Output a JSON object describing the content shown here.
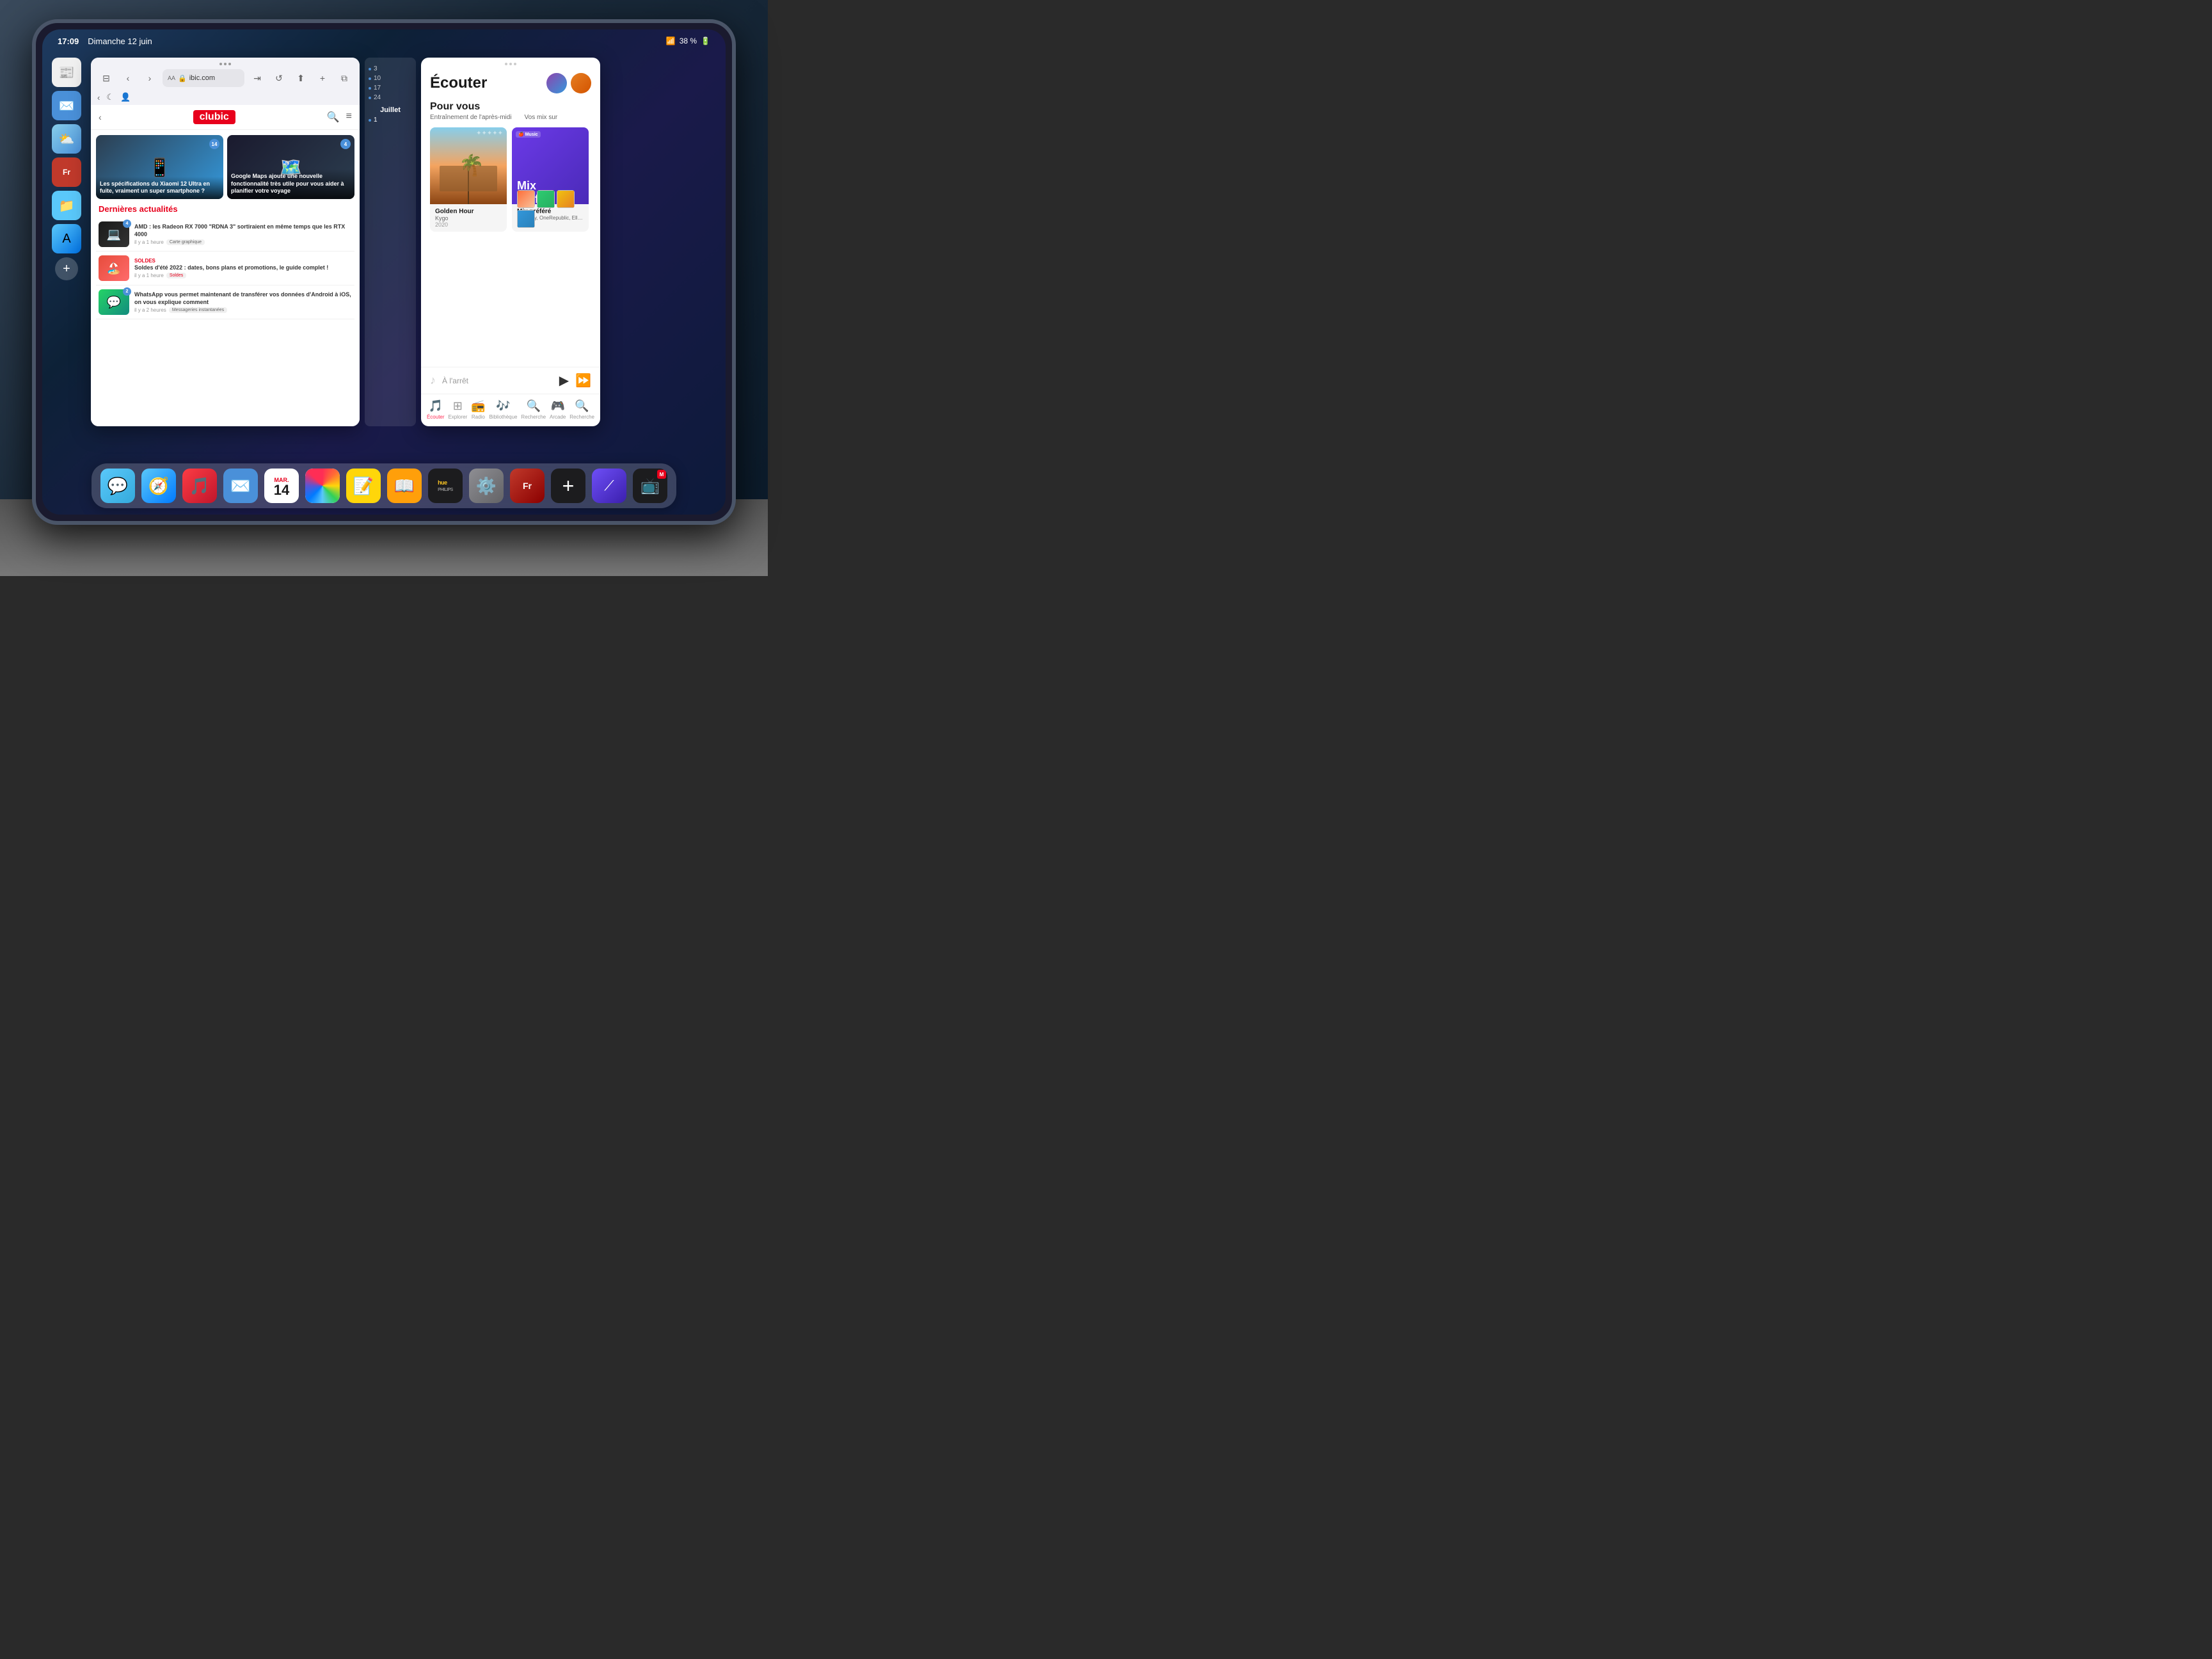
{
  "status_bar": {
    "time": "17:09",
    "date": "Dimanche 12 juin",
    "battery": "38 %",
    "wifi": "▾"
  },
  "browser": {
    "url": "ibic.com",
    "logo": "clubic",
    "nav_dots": "···",
    "article1": {
      "title": "Les spécifications du Xiaomi 12 Ultra en fuite, vraiment un super smartphone ?",
      "badge": "14"
    },
    "article2": {
      "title": "Google Maps ajoute une nouvelle fonctionnalité très utile pour vous aider à planifier votre voyage",
      "badge": "4"
    },
    "section_title": "Dernières actualités",
    "news": [
      {
        "title": "AMD : les Radeon RX 7000 \"RDNA 3\" sortiraient en même temps que les RTX 4000",
        "time": "il y a 1 heure",
        "tag": "Carte graphique",
        "badge": "4"
      },
      {
        "title": "Soldes d'été 2022 : dates, bons plans et promotions, le guide complet !",
        "time": "il y a 1 heure",
        "tag": "Soldes",
        "badge": null,
        "label": "SOLDES"
      },
      {
        "title": "WhatsApp vous permet maintenant de transférer vos données d'Android à iOS, on vous explique comment",
        "time": "il y a 2 heures",
        "tag": "Messageries instantanées",
        "badge": "2"
      }
    ]
  },
  "calendar": {
    "days": [
      "3",
      "10",
      "17",
      "24"
    ],
    "month": "Juillet",
    "day1": "1"
  },
  "music": {
    "header_title": "Écouter",
    "section": "Pour vous",
    "subsection1": "Entraînement de l'après-midi",
    "subsection2": "Vos mix sur",
    "album1": {
      "title": "Golden Hour",
      "artist": "Kygo",
      "year": "2020"
    },
    "album2": {
      "title": "Mix préféré",
      "artists": "Coldplay, OneRepublic, Ella Fitzgerald"
    },
    "status": "À l'arrêt",
    "nav": [
      "Écouter",
      "Explorer",
      "Radio",
      "Bibliothèque",
      "Recherche",
      "Arcade",
      "Recherche"
    ],
    "dots": "···"
  },
  "dock": {
    "apps": [
      {
        "name": "Messages",
        "label": "💬"
      },
      {
        "name": "Safari",
        "label": "🧭"
      },
      {
        "name": "Musique",
        "label": "🎵"
      },
      {
        "name": "Mail",
        "label": "✉️"
      },
      {
        "name": "Calendrier",
        "month": "MAR.",
        "day": "14"
      },
      {
        "name": "Photos"
      },
      {
        "name": "Notes",
        "label": "📝"
      },
      {
        "name": "Livres",
        "label": "📖"
      },
      {
        "name": "Hue",
        "label": "hue"
      },
      {
        "name": "Réglages",
        "label": "⚙️"
      },
      {
        "name": "French",
        "label": "Fr"
      },
      {
        "name": "Plus",
        "label": "+"
      },
      {
        "name": "Linear",
        "label": "⟋"
      },
      {
        "name": "Multistore",
        "label": "🎬"
      }
    ]
  }
}
